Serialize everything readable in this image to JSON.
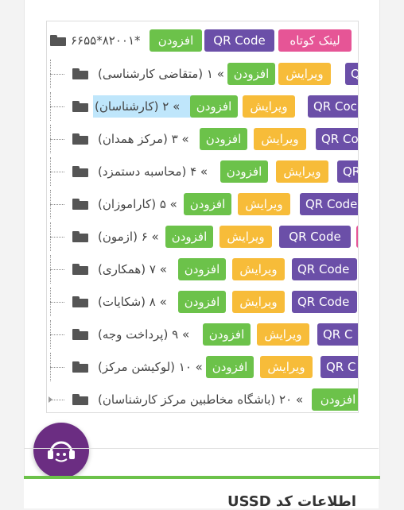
{
  "root": {
    "title": "۶۶۵۵*۸۲۰۰۱*",
    "add_label": "افزودن",
    "qr_label": "QR Code",
    "short_link_label": "لینک کوتاه"
  },
  "items": [
    {
      "title": "(متقاضی کارشناسی) ۱ «",
      "add": "افزودن",
      "edit": "ویرایش",
      "qr": "Q"
    },
    {
      "title": "(کارشناسان) ۲ «",
      "add": "افزودن",
      "edit": "ویرایش",
      "qr": "QR Coc"
    },
    {
      "title": "(مرکز همدان) ۳ «",
      "add": "افزودن",
      "edit": "ویرایش",
      "qr": "QR Co"
    },
    {
      "title": "(محاسبه دستمزد) ۴ «",
      "add": "افزودن",
      "edit": "ویرایش",
      "qr": "QR"
    },
    {
      "title": "(کاراموزان) ۵ «",
      "add": "افزودن",
      "edit": "ویرایش",
      "qr": "QR Code"
    },
    {
      "title": "(ازمون) ۶ «",
      "add": "افزودن",
      "edit": "ویرایش",
      "qr": "QR Code"
    },
    {
      "title": "(همکاری) ۷ «",
      "add": "افزودن",
      "edit": "ویرایش",
      "qr": "QR Code"
    },
    {
      "title": "(شکایات) ۸ «",
      "add": "افزودن",
      "edit": "ویرایش",
      "qr": "QR Code"
    },
    {
      "title": "(پرداخت وجه) ۹ «",
      "add": "افزودن",
      "edit": "ویرایش",
      "qr": "QR C"
    },
    {
      "title": "(لوکیشن مرکز) ۱۰ «",
      "add": "افزودن",
      "edit": "ویرایش",
      "qr": "QR C"
    },
    {
      "title": "(باشگاه مخاطبین مرکز کارشناسان) ۲۰ «",
      "add": "افزودن",
      "edit": "",
      "qr": ""
    }
  ],
  "ussd": {
    "title": "اطلاعات کد USSD"
  },
  "colors": {
    "add": "#6cc24a",
    "edit": "#f7bc39",
    "qr": "#6b4fa8",
    "short_link": "#e65596",
    "support": "#6b2d82",
    "selected": "#bfe6fb"
  }
}
